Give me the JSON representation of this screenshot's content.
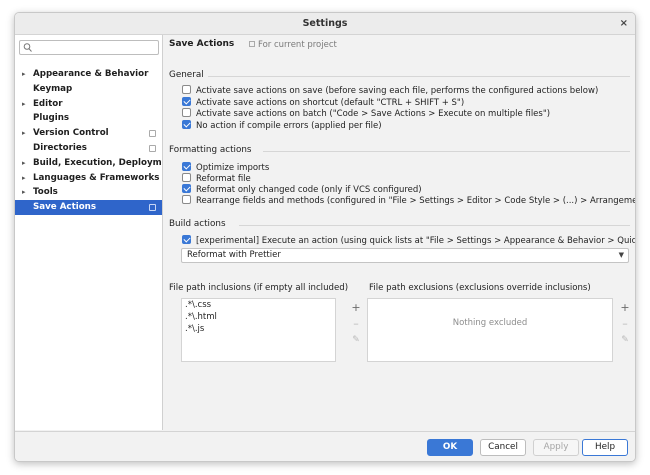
{
  "window": {
    "title": "Settings",
    "close_glyph": "×"
  },
  "sidebar": {
    "search": {
      "value": "",
      "placeholder": ""
    },
    "items": [
      {
        "label": "Appearance & Behavior",
        "arrow": "▸",
        "project_icon": false,
        "selected": false
      },
      {
        "label": "Keymap",
        "arrow": "",
        "project_icon": false,
        "selected": false
      },
      {
        "label": "Editor",
        "arrow": "▸",
        "project_icon": false,
        "selected": false
      },
      {
        "label": "Plugins",
        "arrow": "",
        "project_icon": false,
        "selected": false
      },
      {
        "label": "Version Control",
        "arrow": "▸",
        "project_icon": true,
        "selected": false
      },
      {
        "label": "Directories",
        "arrow": "",
        "project_icon": true,
        "selected": false
      },
      {
        "label": "Build, Execution, Deployment",
        "arrow": "▸",
        "project_icon": false,
        "selected": false
      },
      {
        "label": "Languages & Frameworks",
        "arrow": "▸",
        "project_icon": false,
        "selected": false
      },
      {
        "label": "Tools",
        "arrow": "▸",
        "project_icon": false,
        "selected": false
      },
      {
        "label": "Save Actions",
        "arrow": "",
        "project_icon": true,
        "selected": true
      }
    ]
  },
  "content": {
    "title": "Save Actions",
    "scope": "For current project",
    "general": {
      "label": "General",
      "options": [
        {
          "label": "Activate save actions on save (before saving each file, performs the configured actions below)",
          "checked": false
        },
        {
          "label": "Activate save actions on shortcut (default \"CTRL + SHIFT + S\")",
          "checked": true
        },
        {
          "label": "Activate save actions on batch (\"Code > Save Actions > Execute on multiple files\")",
          "checked": false
        },
        {
          "label": "No action if compile errors (applied per file)",
          "checked": true
        }
      ]
    },
    "formatting": {
      "label": "Formatting actions",
      "options": [
        {
          "label": "Optimize imports",
          "checked": true
        },
        {
          "label": "Reformat file",
          "checked": false
        },
        {
          "label": "Reformat only changed code (only if VCS configured)",
          "checked": true
        },
        {
          "label": "Rearrange fields and methods (configured in \"File > Settings > Editor > Code Style > (...) > Arrangement\")",
          "checked": false
        }
      ]
    },
    "build": {
      "label": "Build actions",
      "option": {
        "label": "[experimental] Execute an action (using quick lists at \"File > Settings > Appearance & Behavior > Quick Lists\")",
        "checked": true
      },
      "dropdown_value": "Reformat with Prettier"
    },
    "inclusions": {
      "label": "File path inclusions (if empty all included)",
      "items": [
        ".*\\.css",
        ".*\\.html",
        ".*\\.js"
      ]
    },
    "exclusions": {
      "label": "File path exclusions (exclusions override inclusions)",
      "empty_text": "Nothing excluded"
    },
    "tool_glyphs": {
      "add": "+",
      "remove": "–",
      "edit": "✎"
    }
  },
  "footer": {
    "ok": "OK",
    "cancel": "Cancel",
    "apply": "Apply",
    "help": "Help"
  },
  "colors": {
    "accent": "#3a78d6",
    "selection": "#2f65ca"
  }
}
